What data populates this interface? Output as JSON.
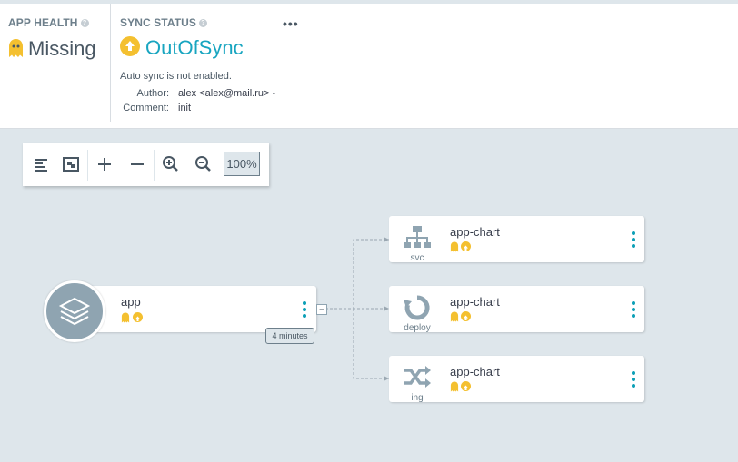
{
  "health": {
    "title": "APP HEALTH",
    "status": "Missing",
    "help_icon": "?"
  },
  "sync": {
    "title": "SYNC STATUS",
    "status": "OutOfSync",
    "help_icon": "?",
    "menu": "•••",
    "auto_sync_msg": "Auto sync is not enabled.",
    "author_label": "Author:",
    "author_value": "alex <alex@mail.ru> -",
    "comment_label": "Comment:",
    "comment_value": "init"
  },
  "toolbar": {
    "zoom": "100%"
  },
  "graph": {
    "root": {
      "name": "app",
      "age": "4 minutes",
      "collapse": "–"
    },
    "children": [
      {
        "name": "app-chart",
        "kind": "svc"
      },
      {
        "name": "app-chart",
        "kind": "deploy"
      },
      {
        "name": "app-chart",
        "kind": "ing"
      }
    ]
  },
  "colors": {
    "accent": "#18a5c0",
    "warning": "#f4c030",
    "background": "#dee6eb"
  }
}
